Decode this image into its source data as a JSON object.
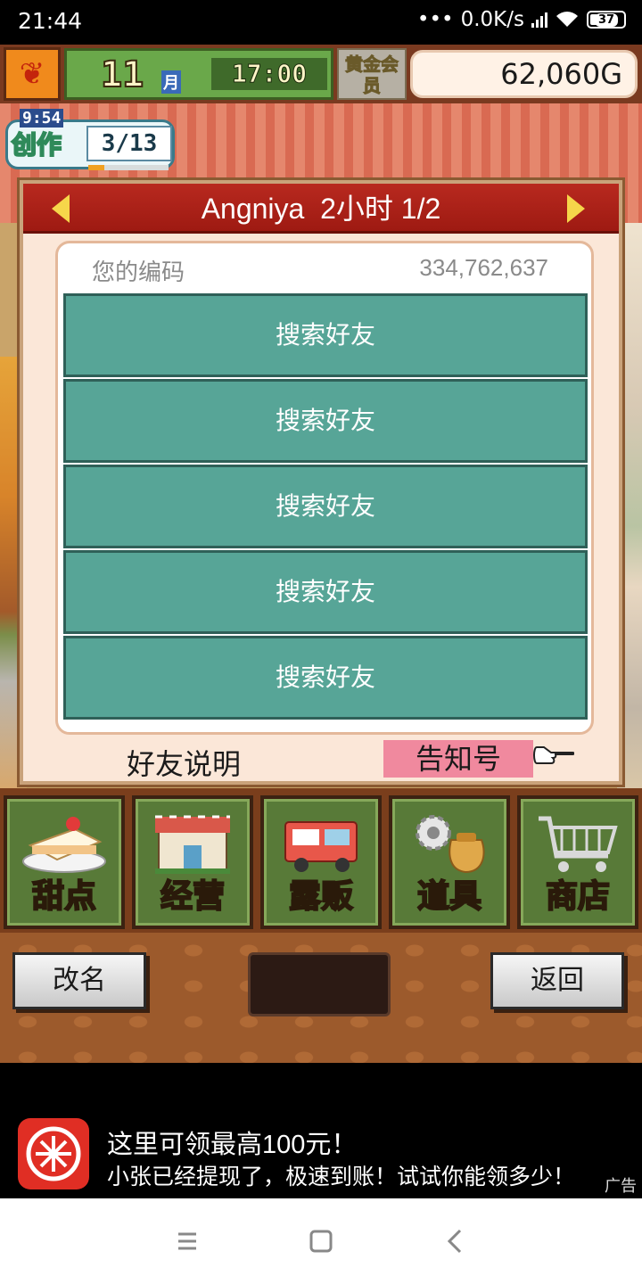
{
  "status_bar": {
    "time": "21:44",
    "network_speed": "0.0K/s",
    "battery": "37"
  },
  "hud": {
    "month_value": "11",
    "month_unit": "月",
    "clock": "17:00",
    "member_badge": "黄金会员",
    "gold": "62,060",
    "gold_unit": "G"
  },
  "craft": {
    "timer": "9:54",
    "label": "创作",
    "count": "3/13",
    "progress": 0.2
  },
  "dialog": {
    "title": "Angniya  2小时 1/2",
    "code_label": "您的编码",
    "code_value": "334,762,637",
    "slots": [
      "搜索好友",
      "搜索好友",
      "搜索好友",
      "搜索好友",
      "搜索好友"
    ],
    "friend_info_label": "好友说明",
    "notify_label": "告知号"
  },
  "menu": [
    {
      "label": "甜点",
      "icon": "cake-icon"
    },
    {
      "label": "经营",
      "icon": "shop-building-icon"
    },
    {
      "label": "露贩",
      "icon": "food-truck-icon"
    },
    {
      "label": "道具",
      "icon": "gear-sack-icon"
    },
    {
      "label": "商店",
      "icon": "shopping-cart-icon"
    }
  ],
  "bottom": {
    "rename_label": "改名",
    "back_label": "返回"
  },
  "ad": {
    "title": "这里可领最高100元！",
    "subtitle": "小张已经提现了，极速到账！试试你能领多少！",
    "tag": "广告"
  },
  "colors": {
    "header_red": "#9e1a12",
    "slot_teal": "#57a597",
    "notify_pink": "#f0899e",
    "menu_green": "#587a38"
  }
}
